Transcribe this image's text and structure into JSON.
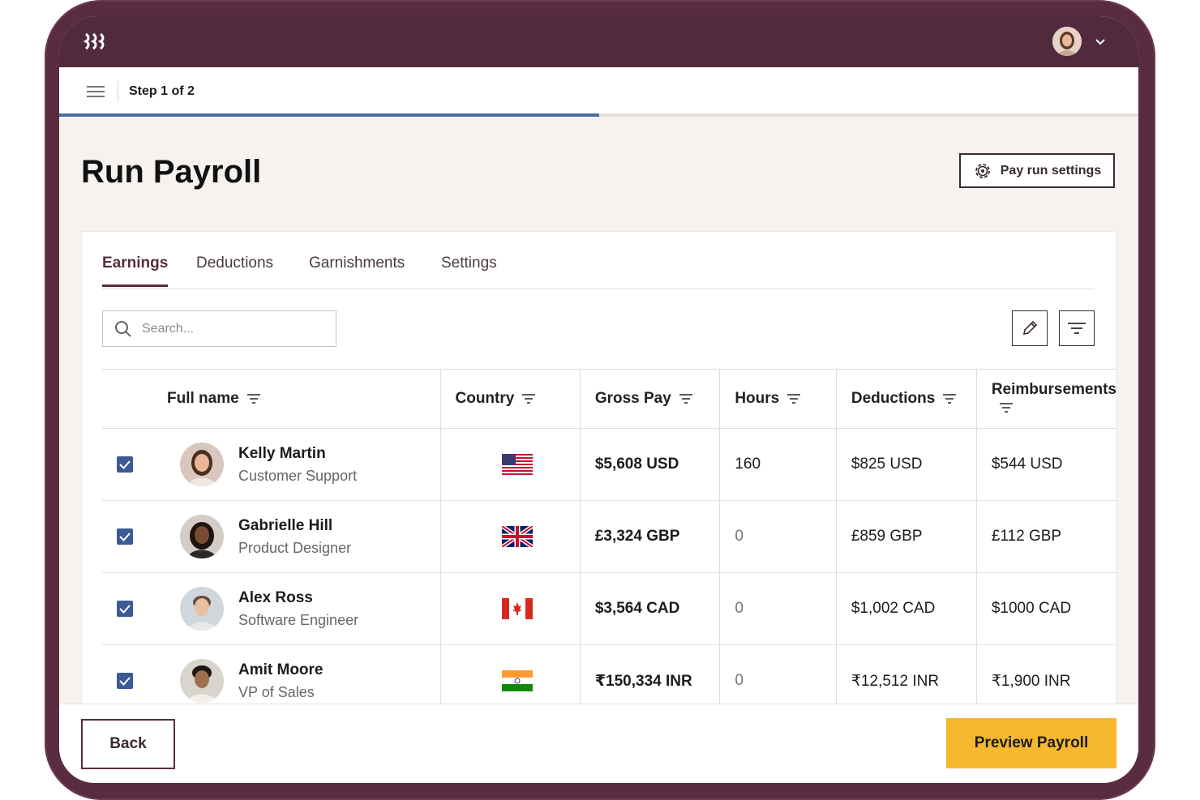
{
  "step": {
    "label": "Step 1 of 2",
    "progress_fraction": 0.5
  },
  "page": {
    "title": "Run Payroll",
    "settings_button": "Pay run settings"
  },
  "tabs": [
    {
      "label": "Earnings",
      "active": true
    },
    {
      "label": "Deductions",
      "active": false
    },
    {
      "label": "Garnishments",
      "active": false
    },
    {
      "label": "Settings",
      "active": false
    }
  ],
  "search": {
    "placeholder": "Search..."
  },
  "table": {
    "headers": [
      "Full name",
      "Country",
      "Gross Pay",
      "Hours",
      "Deductions",
      "Reimbursements"
    ],
    "rows": [
      {
        "name": "Kelly Martin",
        "role": "Customer Support",
        "flag": "us-flag",
        "gross": "$5,608 USD",
        "hours": "160",
        "deductions": "$825 USD",
        "reimbursements": "$544 USD",
        "checked": true
      },
      {
        "name": "Gabrielle Hill",
        "role": "Product Designer",
        "flag": "uk-flag",
        "gross": "£3,324 GBP",
        "hours": "0",
        "deductions": "£859 GBP",
        "reimbursements": "£112 GBP",
        "checked": true
      },
      {
        "name": "Alex Ross",
        "role": "Software Engineer",
        "flag": "canada-flag",
        "gross": "$3,564 CAD",
        "hours": "0",
        "deductions": "$1,002 CAD",
        "reimbursements": "$1000 CAD",
        "checked": true
      },
      {
        "name": "Amit Moore",
        "role": "VP of Sales",
        "flag": "india-flag",
        "gross": "₹150,334 INR",
        "hours": "0",
        "deductions": "₹12,512 INR",
        "reimbursements": "₹1,900 INR",
        "checked": true
      }
    ]
  },
  "footer": {
    "back_label": "Back",
    "preview_label": "Preview Payroll"
  },
  "colors": {
    "frame": "#5a2c40",
    "topbar": "#522a3d",
    "accent_yellow": "#f5b82e",
    "progress": "#4a6aa8",
    "checkbox": "#3c5a94"
  }
}
